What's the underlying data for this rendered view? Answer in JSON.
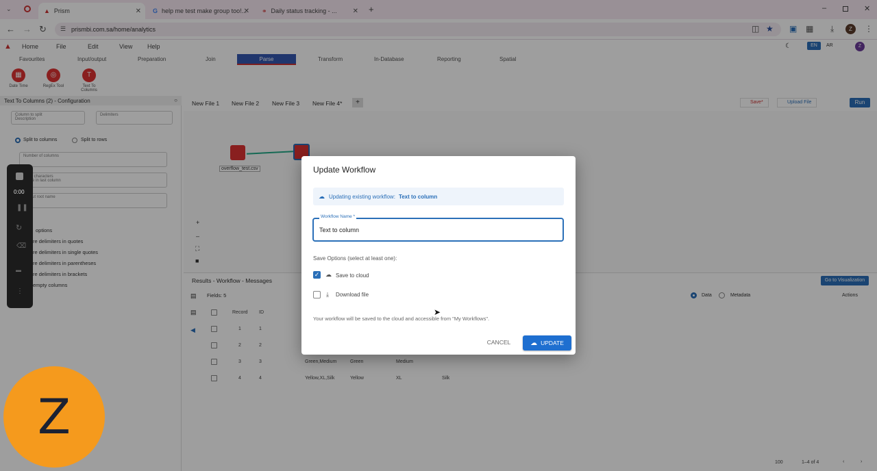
{
  "browser": {
    "tabs": [
      {
        "label": "Prism",
        "active": true
      },
      {
        "label": "help me test make group too!...",
        "active": false
      },
      {
        "label": "Daily status tracking - ...",
        "active": false
      }
    ],
    "url": "prismbi.com.sa/home/analytics",
    "profile_initial": "Z"
  },
  "app": {
    "menu": [
      "Home",
      "File",
      "Edit",
      "View",
      "Help"
    ],
    "lang": {
      "en": "EN",
      "ar": "AR"
    },
    "user_initial": "Z",
    "ribbon_tabs": [
      "Favourites",
      "Input/output",
      "Preparation",
      "Join",
      "Parse",
      "Transform",
      "In-Database",
      "Reporting",
      "Spatial"
    ],
    "tools": [
      "Date Time",
      "RegEx Tool",
      "Text To Columns"
    ],
    "config_title": "Text To Columns (2) - Configuration",
    "config": {
      "column_to_split": "Column to split",
      "column_to_split_value": "Description",
      "delimiters": "Delimiters",
      "split_to_columns": "Split to columns",
      "split_to_rows": "Split to rows",
      "number_of_columns": "Number of columns",
      "extra_chars": "Extra characters",
      "extra_chars_value": "Leave in last column",
      "output_root": "Output root name",
      "options_label": "options",
      "options": [
        "re delimiters in quotes",
        "re delimiters in single quotes",
        "re delimiters in parentheses",
        "re delimiters in brackets",
        "empty columns"
      ]
    },
    "file_tabs": [
      "New File 1",
      "New File 2",
      "New File 3",
      "New File 4*"
    ],
    "actions": {
      "save": "Save*",
      "upload": "Upload File",
      "run": "Run"
    },
    "canvas_node_label": "overflow_test.csv",
    "results": {
      "title": "Results - Workflow - Messages",
      "fields": "Fields: 5",
      "go_viz": "Go to Visualization",
      "data": "Data",
      "metadata": "Metadata",
      "actions": "Actions",
      "headers": [
        "Record",
        "ID"
      ],
      "rows": [
        [
          "1",
          "1",
          "",
          "",
          "",
          ""
        ],
        [
          "2",
          "2",
          "",
          "",
          "",
          ""
        ],
        [
          "3",
          "3",
          "Green,Medium",
          "Green",
          "Medium",
          ""
        ],
        [
          "4",
          "4",
          "Yellow,XL,Silk",
          "Yellow",
          "XL",
          "Silk"
        ]
      ],
      "page_size": "100",
      "page_info": "1–4 of 4"
    }
  },
  "recorder": {
    "time": "0:00"
  },
  "dialog": {
    "title": "Update Workflow",
    "info_prefix": "Updating existing workflow:",
    "info_name": "Text to column",
    "name_label": "Workflow Name *",
    "name_value": "Text to column",
    "save_options_label": "Save Options (select at least one):",
    "save_to_cloud": "Save to cloud",
    "save_to_cloud_checked": true,
    "download_file": "Download file",
    "download_file_checked": false,
    "note": "Your workflow will be saved to the cloud and accessible from \"My Workflows\".",
    "cancel": "CANCEL",
    "update": "UPDATE"
  },
  "colors": {
    "accent": "#2a6fb8",
    "brand": "#d33",
    "avatar": "#f59a1d"
  }
}
